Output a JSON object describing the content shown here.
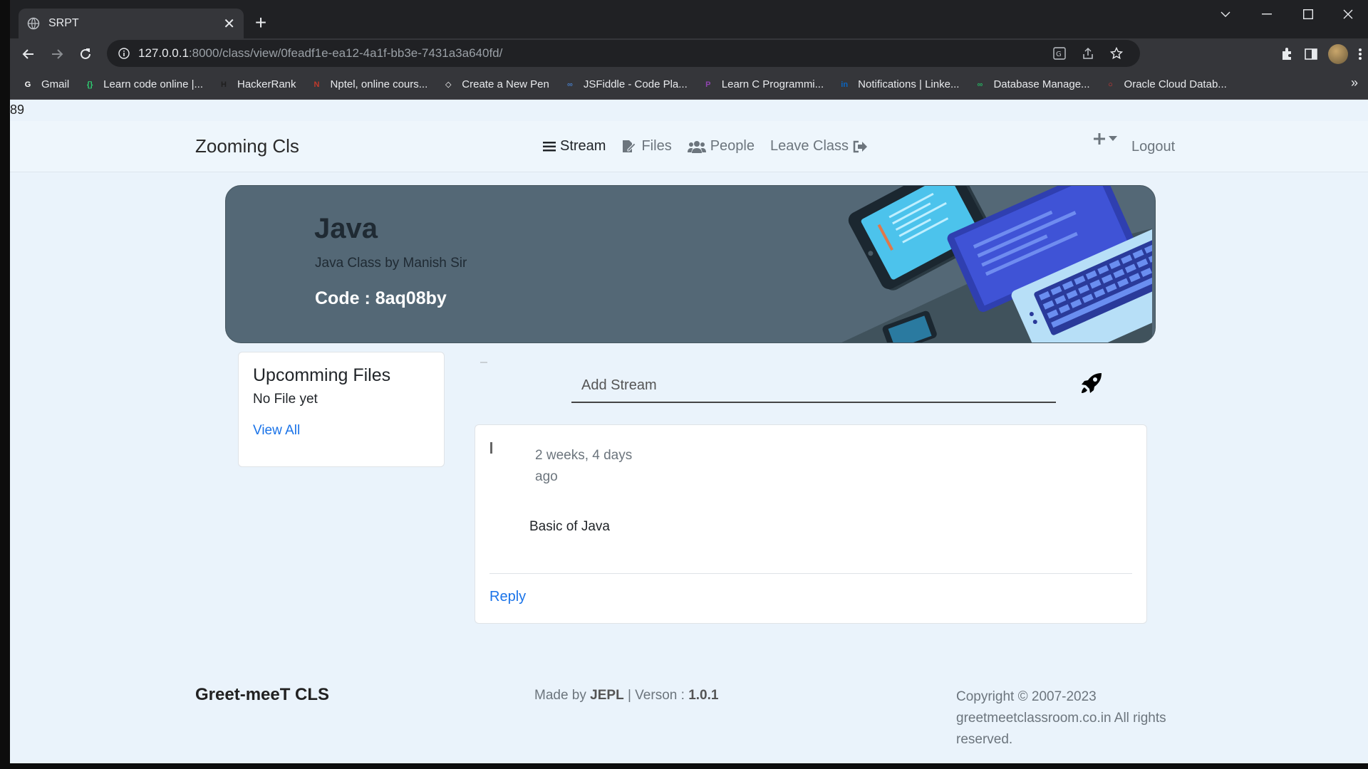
{
  "browser": {
    "tab_title": "SRPT",
    "url_host": "127.0.0.1",
    "url_path": ":8000/class/view/0feadf1e-ea12-4a1f-bb3e-7431a3a640fd/",
    "bookmarks": [
      {
        "label": "Gmail",
        "icon": "google-icon",
        "color": "#ffffff"
      },
      {
        "label": "Learn code online |...",
        "icon": "code-icon",
        "color": "#2ecc71"
      },
      {
        "label": "HackerRank",
        "icon": "hackerrank-icon",
        "color": "#1f1f1f"
      },
      {
        "label": "Nptel, online cours...",
        "icon": "nptel-icon",
        "color": "#c0392b"
      },
      {
        "label": "Create a New Pen",
        "icon": "codepen-icon",
        "color": "#ffffff"
      },
      {
        "label": "JSFiddle - Code Pla...",
        "icon": "jsfiddle-icon",
        "color": "#4679bd"
      },
      {
        "label": "Learn C Programmi...",
        "icon": "programiz-icon",
        "color": "#8e44ad"
      },
      {
        "label": "Notifications | Linke...",
        "icon": "linkedin-icon",
        "color": "#0a66c2"
      },
      {
        "label": "Database Manage...",
        "icon": "database-icon",
        "color": "#27ae60"
      },
      {
        "label": "Oracle Cloud Datab...",
        "icon": "oracle-icon",
        "color": "#e53935"
      }
    ]
  },
  "page": {
    "counter": "89",
    "nav": {
      "brand": "Zooming Cls",
      "stream": "Stream",
      "files": "Files",
      "people": "People",
      "leave": "Leave Class",
      "logout": "Logout"
    },
    "banner": {
      "course": "Java",
      "subtitle": "Java Class by Manish Sir",
      "code": "Code : 8aq08by"
    },
    "files_card": {
      "title": "Upcomming Files",
      "empty": "No File yet",
      "view_all": "View All"
    },
    "stream": {
      "placeholder": "Add Stream"
    },
    "post": {
      "time": "2 weeks, 4 days ago",
      "body": "Basic of Java",
      "reply": "Reply"
    },
    "footer": {
      "brand": "Greet-meeT CLS",
      "made_prefix": "Made by",
      "made_by": "JEPL",
      "version_prefix": "| Verson :",
      "version": "1.0.1",
      "copyright": "Copyright © 2007-2023 greetmeetclassroom.co.in All rights reserved."
    }
  },
  "colors": {
    "banner_bg": "#546876",
    "page_bg": "#eaf3fb",
    "link": "#1a73e8"
  }
}
